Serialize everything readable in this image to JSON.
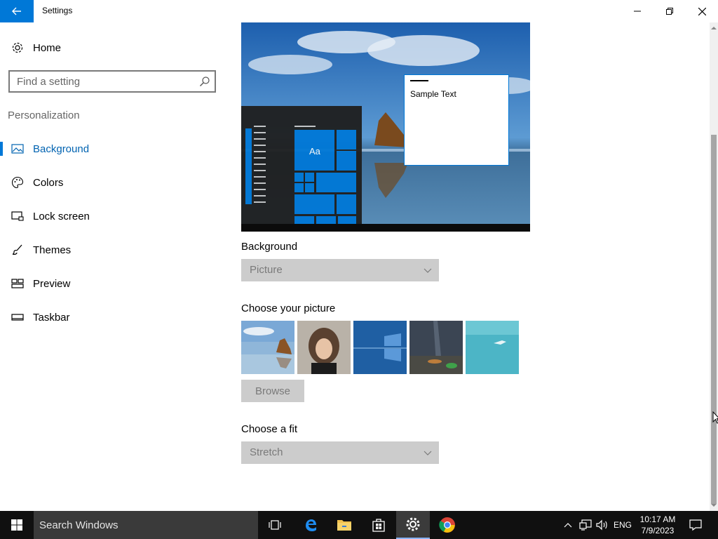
{
  "window": {
    "title": "Settings"
  },
  "sidebar": {
    "home_label": "Home",
    "search_placeholder": "Find a setting",
    "section_title": "Personalization",
    "items": [
      {
        "label": "Background",
        "icon": "picture-icon",
        "active": true
      },
      {
        "label": "Colors",
        "icon": "palette-icon",
        "active": false
      },
      {
        "label": "Lock screen",
        "icon": "lock-screen-icon",
        "active": false
      },
      {
        "label": "Themes",
        "icon": "brush-icon",
        "active": false
      },
      {
        "label": "Preview",
        "icon": "preview-grid-icon",
        "active": false
      },
      {
        "label": "Taskbar",
        "icon": "taskbar-icon",
        "active": false
      }
    ]
  },
  "preview": {
    "sample_text": "Sample Text",
    "tile_text": "Aa"
  },
  "background_section": {
    "label": "Background",
    "selected": "Picture"
  },
  "picture_section": {
    "label": "Choose your picture",
    "browse_label": "Browse",
    "thumbnails": [
      "beach-rock",
      "person-portrait",
      "windows-logo",
      "night-sky",
      "underwater-swimmer"
    ]
  },
  "fit_section": {
    "label": "Choose a fit",
    "selected": "Stretch"
  },
  "taskbar": {
    "search_placeholder": "Search Windows",
    "pinned": [
      "task-view-icon",
      "edge-icon",
      "file-explorer-icon",
      "store-icon",
      "settings-icon",
      "chrome-icon"
    ],
    "language": "ENG",
    "time": "10:17 AM",
    "date": "7/9/2023"
  },
  "colors": {
    "accent": "#0078d7",
    "taskbar": "#101010"
  }
}
